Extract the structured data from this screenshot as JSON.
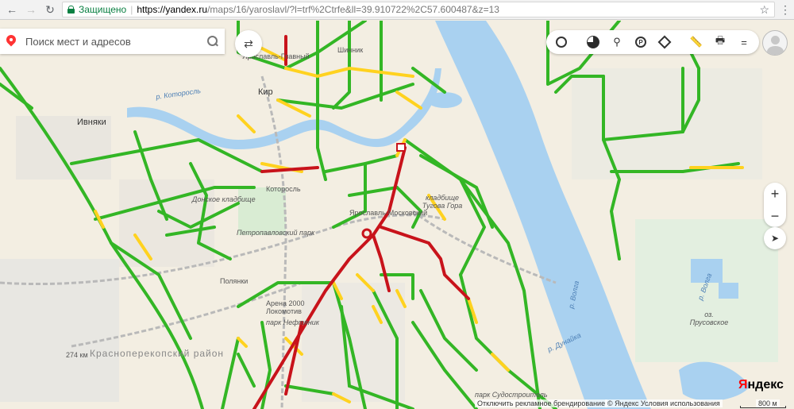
{
  "browser": {
    "back_icon": "back-arrow-icon",
    "forward_icon": "forward-arrow-icon",
    "reload_icon": "reload-icon",
    "secure_label": "Защищено",
    "url_host": "https://yandex.ru",
    "url_rest": "/maps/16/yaroslavl/?l=trf%2Ctrfe&ll=39.910722%2C57.600487&z=13"
  },
  "search": {
    "placeholder": "Поиск мест и адресов"
  },
  "toolbar": {
    "items": [
      "clock-icon",
      "traffic-icon",
      "panorama-icon",
      "parking-icon",
      "layers-icon",
      "ruler-icon",
      "print-icon",
      "menu-icon"
    ],
    "parking_label": "P",
    "menu_label": "="
  },
  "zoom": {
    "plus": "+",
    "minus": "−"
  },
  "colors": {
    "green": "#33b625",
    "yellow": "#ffd21f",
    "red": "#c8131b",
    "water": "#a9d1f0",
    "land": "#f3eee2"
  },
  "labels": {
    "ivnyaki": "Ивняки",
    "shinnik": "Шинник",
    "kirov": "Кир",
    "yaroslavl_glavny": "Ярославль-Главный",
    "kotorosl_river": "р. Которосль",
    "kotorosl_station": "Которосль",
    "yaroslavl_moskovsky": "Ярославль-Московский",
    "cemetery_1": "Донское кладбище",
    "cemetery_2": "кладбище Тугова Гора",
    "petropavlovsky_park": "Петропавловский парк",
    "polyanki": "Полянки",
    "arena": "Арена 2000 Локомотив",
    "park_neftyanik": "парк Нефтяник",
    "krasnoperekopsky": "Красноперекопский район",
    "km_274": "274 км",
    "volga_1": "р. Волга",
    "volga_2": "р. Волга",
    "prusovskoe": "оз. Прусовское",
    "park_sudostroitel": "парк Судостроитель",
    "dunayka": "р. Дунайка",
    "yandex_logo_ya": "Я",
    "yandex_logo_rest": "ндекс"
  },
  "footer": {
    "ads_toggle": "Отключить рекламное брендирование",
    "copyright": "© Яндекс Условия использования",
    "scale": "800 м"
  }
}
